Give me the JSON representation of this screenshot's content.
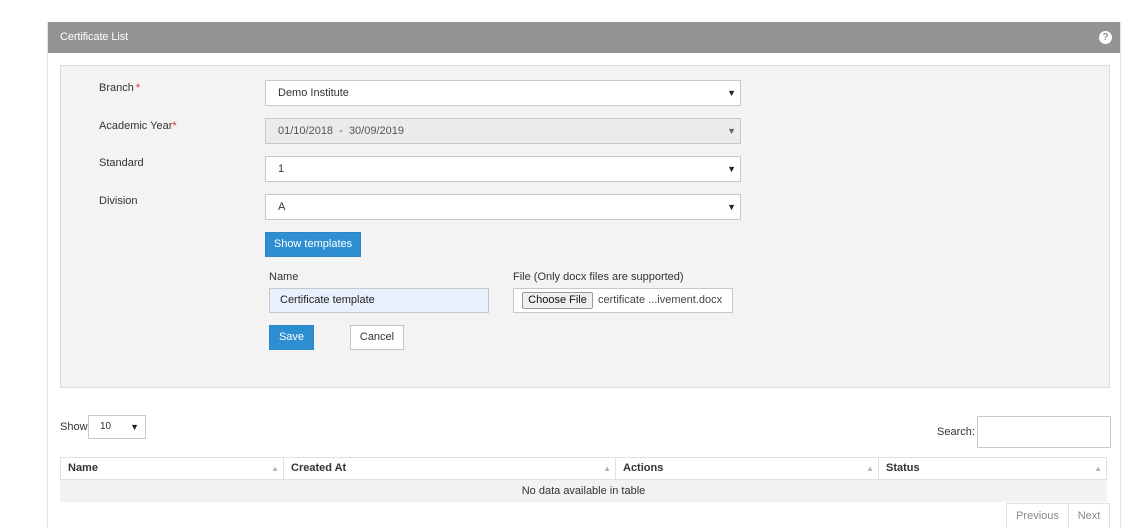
{
  "panel": {
    "title": "Certificate List",
    "help_icon": "question-circle-icon"
  },
  "form": {
    "branch": {
      "label": "Branch",
      "required": "*",
      "value": "Demo Institute"
    },
    "academic_year": {
      "label": "Academic Year",
      "required": "*",
      "value": "01/10/2018  -  30/09/2019"
    },
    "standard": {
      "label": "Standard",
      "value": "1"
    },
    "division": {
      "label": "Division",
      "value": "A"
    },
    "show_templates_label": "Show templates",
    "name_label": "Name",
    "name_value": "Certificate template",
    "file_label": "File (Only docx files are supported)",
    "choose_file_label": "Choose File",
    "file_name": "certificate ...ivement.docx",
    "save_label": "Save",
    "cancel_label": "Cancel"
  },
  "table_controls": {
    "show_label": "Show",
    "page_length": "10",
    "search_label": "Search:"
  },
  "table": {
    "columns": [
      "Name",
      "Created At",
      "Actions",
      "Status"
    ],
    "empty_message": "No data available in table"
  },
  "pagination": {
    "previous_label": "Previous",
    "next_label": "Next"
  },
  "colors": {
    "header_bg": "#939393",
    "primary": "#2d8fd1",
    "required": "#d9302c"
  }
}
